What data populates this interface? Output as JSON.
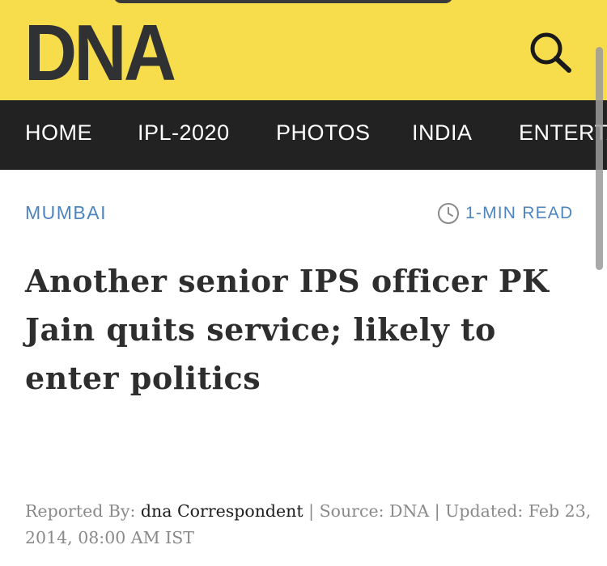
{
  "header": {
    "logo_text": "DNA",
    "search_icon": "search-icon",
    "background_color": "#f7dc4b"
  },
  "nav": {
    "items": [
      {
        "label": "HOME"
      },
      {
        "label": "IPL-2020"
      },
      {
        "label": "PHOTOS"
      },
      {
        "label": "INDIA"
      },
      {
        "label": "ENTERTA"
      }
    ],
    "background_color": "#222222"
  },
  "article": {
    "category": "MUMBAI",
    "read_time": "1-MIN READ",
    "read_time_icon": "clock-icon",
    "headline": "Another senior IPS officer PK Jain quits service; likely to enter politics",
    "byline": {
      "reported_label": "Reported By: ",
      "author": "dna Correspondent",
      "source_label": " | Source: ",
      "source": "DNA",
      "updated_label": " | Updated: ",
      "updated": "Feb 23, 2014, 08:00 AM IST"
    },
    "accent_color": "#4e85bf"
  }
}
